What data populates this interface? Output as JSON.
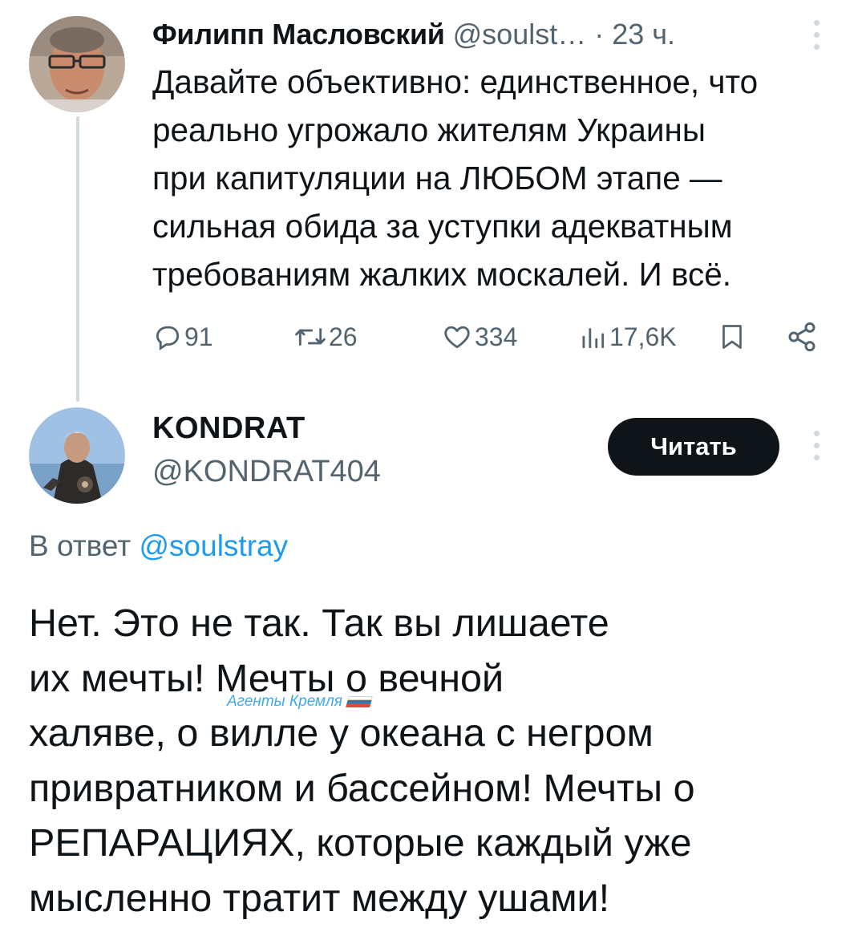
{
  "parent_tweet": {
    "author_name": "Филипп Масловский",
    "author_handle": "@soulst…",
    "separator": "·",
    "time": "23 ч.",
    "text_lines": [
      "Давайте объективно: единственное, что",
      "реально угрожало жителям Украины",
      "при капитуляции на ЛЮБОМ этапе —",
      "сильная обида за уступки адекватным",
      "требованиям жалких москалей. И всё."
    ],
    "replies": "91",
    "retweets": "26",
    "likes": "334",
    "views": "17,6K"
  },
  "reply_tweet": {
    "author_name": "KONDRAT",
    "author_handle": "@KONDRAT404",
    "follow_label": "Читать",
    "reply_prefix": "В ответ",
    "reply_mention": "@soulstray",
    "text_lines": [
      "Нет. Это не так. Так вы лишаете",
      "их мечты! Мечты о вечной",
      "халяве, о вилле  у океана с негром",
      "привратником и бассейном! Мечты о",
      "РЕПАРАЦИЯХ, которые каждый уже",
      "мысленно тратит между ушами!"
    ]
  },
  "watermark": {
    "text": "Агенты Кремля",
    "flag_colors": [
      "#ffffff",
      "#1c57a5",
      "#d52b1e"
    ]
  },
  "icons": {
    "reply": "reply-icon",
    "retweet": "retweet-icon",
    "like": "heart-icon",
    "views": "views-icon",
    "bookmark": "bookmark-icon",
    "share": "share-icon",
    "more": "more-vertical-icon"
  },
  "colors": {
    "text": "#0f1419",
    "secondary": "#536471",
    "link": "#1d9bf0",
    "thread_line": "#cfd9de",
    "button_bg": "#0f1419"
  }
}
